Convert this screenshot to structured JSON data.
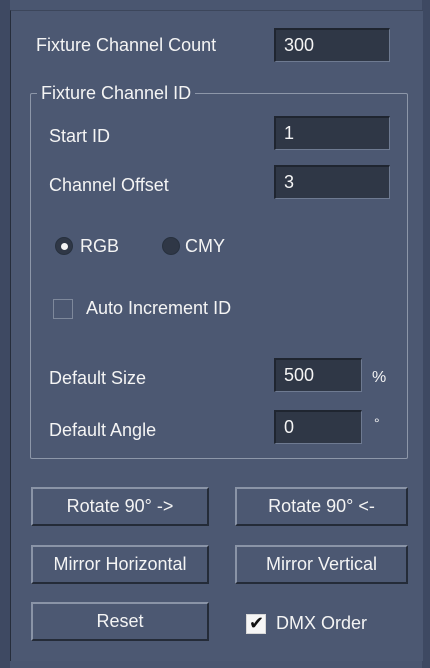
{
  "channel_count": {
    "label": "Fixture Channel Count",
    "value": "300"
  },
  "group": {
    "title": "Fixture Channel ID",
    "start_id": {
      "label": "Start ID",
      "value": "1"
    },
    "channel_offset": {
      "label": "Channel Offset",
      "value": "3"
    },
    "color_mode": {
      "options": [
        "RGB",
        "CMY"
      ],
      "selected": "RGB"
    },
    "auto_increment": {
      "label": "Auto Increment ID",
      "checked": false
    },
    "default_size": {
      "label": "Default Size",
      "value": "500",
      "unit": "%"
    },
    "default_angle": {
      "label": "Default Angle",
      "value": "0",
      "unit": "°"
    }
  },
  "buttons": {
    "rotate_cw": "Rotate 90° ->",
    "rotate_ccw": "Rotate 90° <-",
    "mirror_h": "Mirror Horizontal",
    "mirror_v": "Mirror Vertical",
    "reset": "Reset"
  },
  "dmx_order": {
    "label": "DMX Order",
    "checked": true
  },
  "colors": {
    "background": "#4c5872",
    "field": "#2f3746",
    "text": "#f4f4f4"
  }
}
